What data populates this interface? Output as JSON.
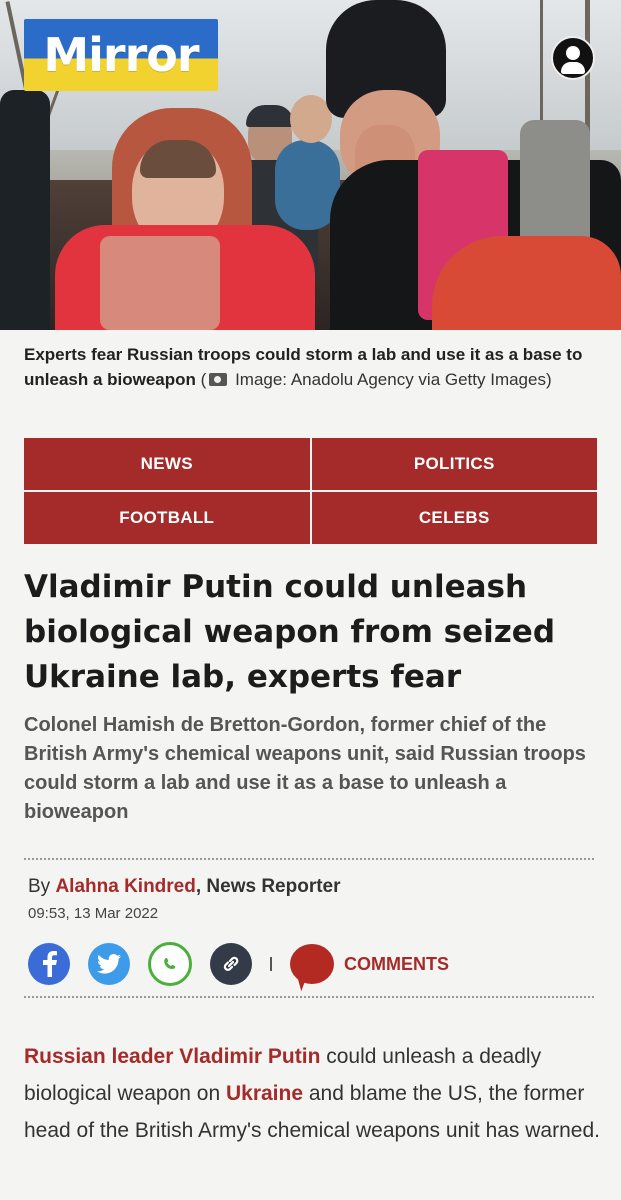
{
  "brand": {
    "logo_text": "Mirror",
    "colors": {
      "accent": "#a52a2a",
      "logo_top": "#2a6cc8",
      "logo_bottom": "#f2d22f"
    }
  },
  "header": {
    "account_icon": "user-circle-icon"
  },
  "caption": {
    "text": "Experts fear Russian troops could storm a lab and use it as a base to unleash a bioweapon",
    "open_paren": "(",
    "camera_icon": "camera-icon",
    "credit": "Image: Anadolu Agency via Getty Images)"
  },
  "nav": {
    "items": [
      "NEWS",
      "POLITICS",
      "FOOTBALL",
      "CELEBS"
    ]
  },
  "article": {
    "headline": "Vladimir Putin could unleash biological weapon from seized Ukraine lab, experts fear",
    "standfirst": "Colonel Hamish de Bretton-Gordon, former chief of the British Army's chemical weapons unit, said Russian troops could storm a lab and use it as a base to unleash a bioweapon",
    "byline_prefix": "By ",
    "author": "Alahna Kindred",
    "author_role": ", News Reporter",
    "timestamp": "09:53, 13 Mar 2022",
    "share": {
      "icons": [
        "facebook-icon",
        "twitter-icon",
        "whatsapp-icon",
        "link-icon"
      ],
      "comments_label": "COMMENTS"
    },
    "body_link_1": "Russian leader Vladimir Putin",
    "body_text_1": " could unleash a deadly biological weapon on ",
    "body_link_2": "Ukraine",
    "body_text_2": " and blame the US, the former head of the British Army's chemical weapons unit has warned."
  }
}
